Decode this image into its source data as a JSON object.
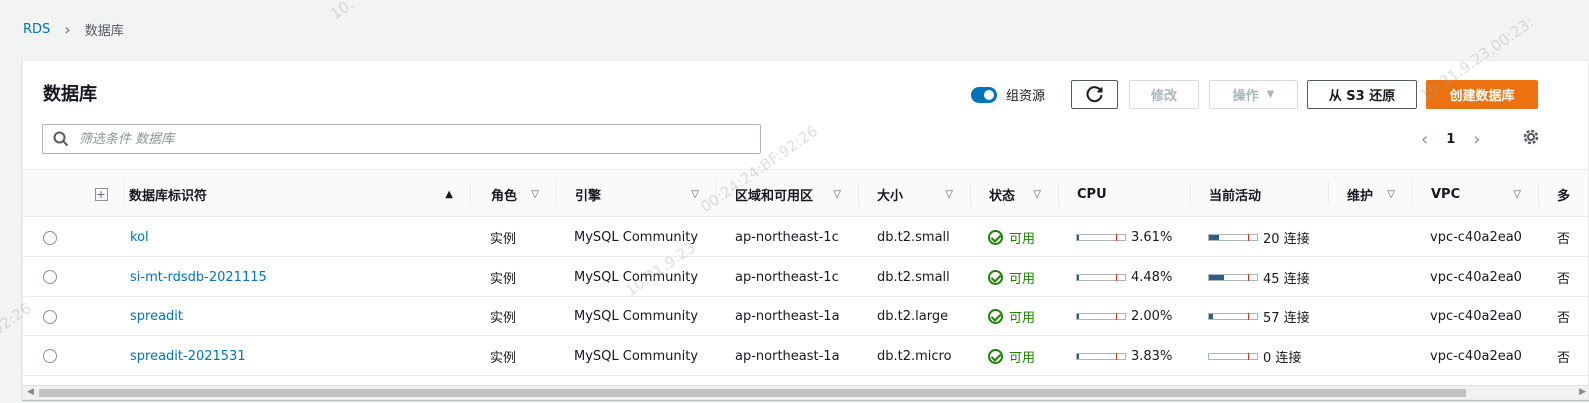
{
  "breadcrumb": {
    "root": "RDS",
    "current": "数据库"
  },
  "panel": {
    "title": "数据库",
    "group_resources_label": "组资源",
    "buttons": {
      "modify": "修改",
      "actions": "操作",
      "restore_s3": "从 S3 还原",
      "create": "创建数据库"
    },
    "search_placeholder": "筛选条件 数据库",
    "page_number": "1"
  },
  "columns": {
    "identifier": "数据库标识符",
    "role": "角色",
    "engine": "引擎",
    "region": "区域和可用区",
    "size": "大小",
    "status": "状态",
    "cpu": "CPU",
    "activity": "当前活动",
    "maintenance": "维护",
    "vpc": "VPC",
    "multi_az": "多"
  },
  "rows": [
    {
      "id": "kol",
      "role": "实例",
      "engine": "MySQL Community",
      "region": "ap-northeast-1c",
      "size": "db.t2.small",
      "status": "可用",
      "cpu": "3.61%",
      "cpu_value": 3.61,
      "activity": "20 连接",
      "activity_fraction": 0.2,
      "vpc": "vpc-c40a2ea0",
      "multi_az": "否"
    },
    {
      "id": "si-mt-rdsdb-2021115",
      "role": "实例",
      "engine": "MySQL Community",
      "region": "ap-northeast-1c",
      "size": "db.t2.small",
      "status": "可用",
      "cpu": "4.48%",
      "cpu_value": 4.48,
      "activity": "45 连接",
      "activity_fraction": 0.3,
      "vpc": "vpc-c40a2ea0",
      "multi_az": "否"
    },
    {
      "id": "spreadit",
      "role": "实例",
      "engine": "MySQL Community",
      "region": "ap-northeast-1a",
      "size": "db.t2.large",
      "status": "可用",
      "cpu": "2.00%",
      "cpu_value": 2.0,
      "activity": "57 连接",
      "activity_fraction": 0.08,
      "vpc": "vpc-c40a2ea0",
      "multi_az": "否"
    },
    {
      "id": "spreadit-2021531",
      "role": "实例",
      "engine": "MySQL Community",
      "region": "ap-northeast-1a",
      "size": "db.t2.micro",
      "status": "可用",
      "cpu": "3.83%",
      "cpu_value": 3.83,
      "activity": "0 连接",
      "activity_fraction": 0.0,
      "vpc": "vpc-c40a2ea0",
      "multi_az": "否"
    }
  ],
  "colors": {
    "link": "#0073bb",
    "primary": "#ec7211",
    "success": "#1d8102"
  }
}
